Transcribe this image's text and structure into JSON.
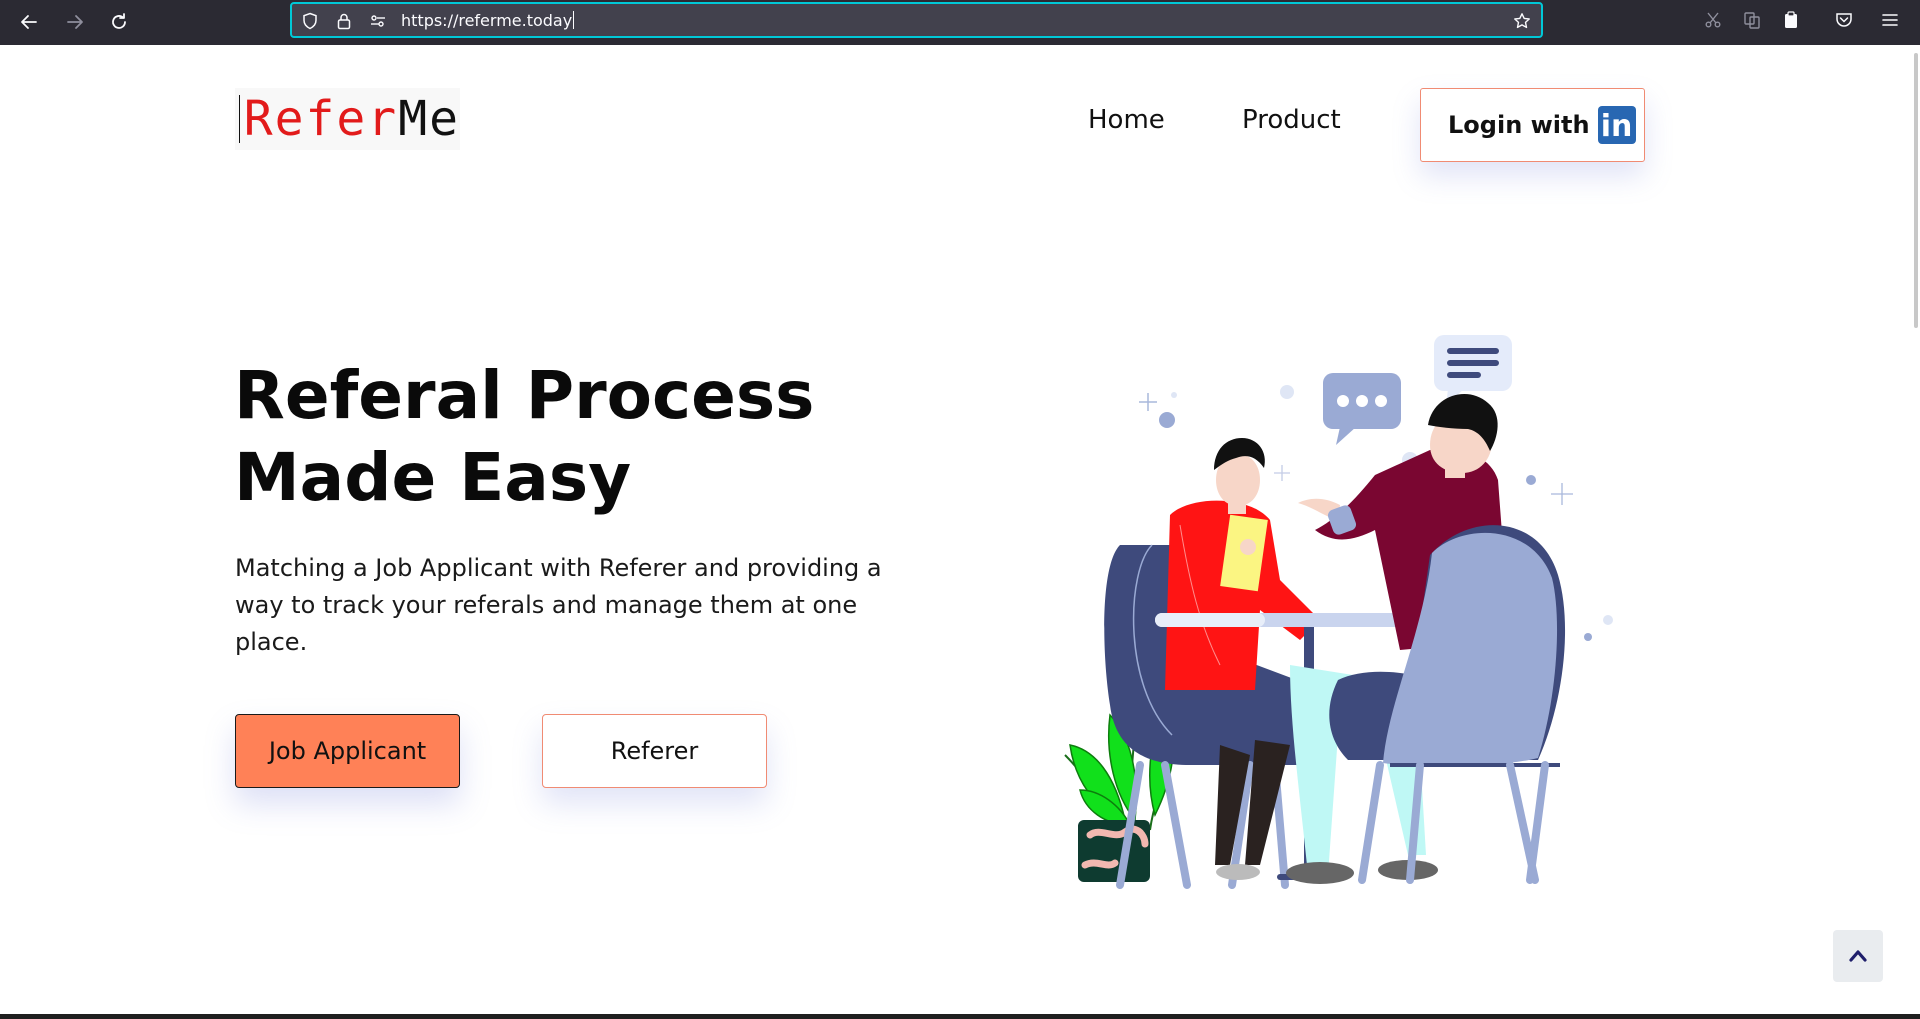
{
  "browser": {
    "url": "https://referme.today",
    "back_icon": "arrow-left-icon",
    "forward_icon": "arrow-right-icon",
    "reload_icon": "reload-icon",
    "bookmark_icon": "star-icon"
  },
  "header": {
    "logo_part1": "Refer",
    "logo_part2": "Me",
    "nav": [
      {
        "label": "Home"
      },
      {
        "label": "Product"
      }
    ],
    "login_label": "Login with",
    "login_icon_text": "in"
  },
  "hero": {
    "title_line1": "Referal Process",
    "title_line2": "Made Easy",
    "subtitle": "Matching a Job Applicant with Referer and providing a way to track your referals and manage them at one place.",
    "primary_button": "Job Applicant",
    "secondary_button": "Referer"
  },
  "colors": {
    "accent": "#ff8157",
    "accent_border": "#f08b73",
    "logo_red": "#e21b1b",
    "linkedin_blue": "#2867b2",
    "url_focus": "#00c8d7"
  }
}
